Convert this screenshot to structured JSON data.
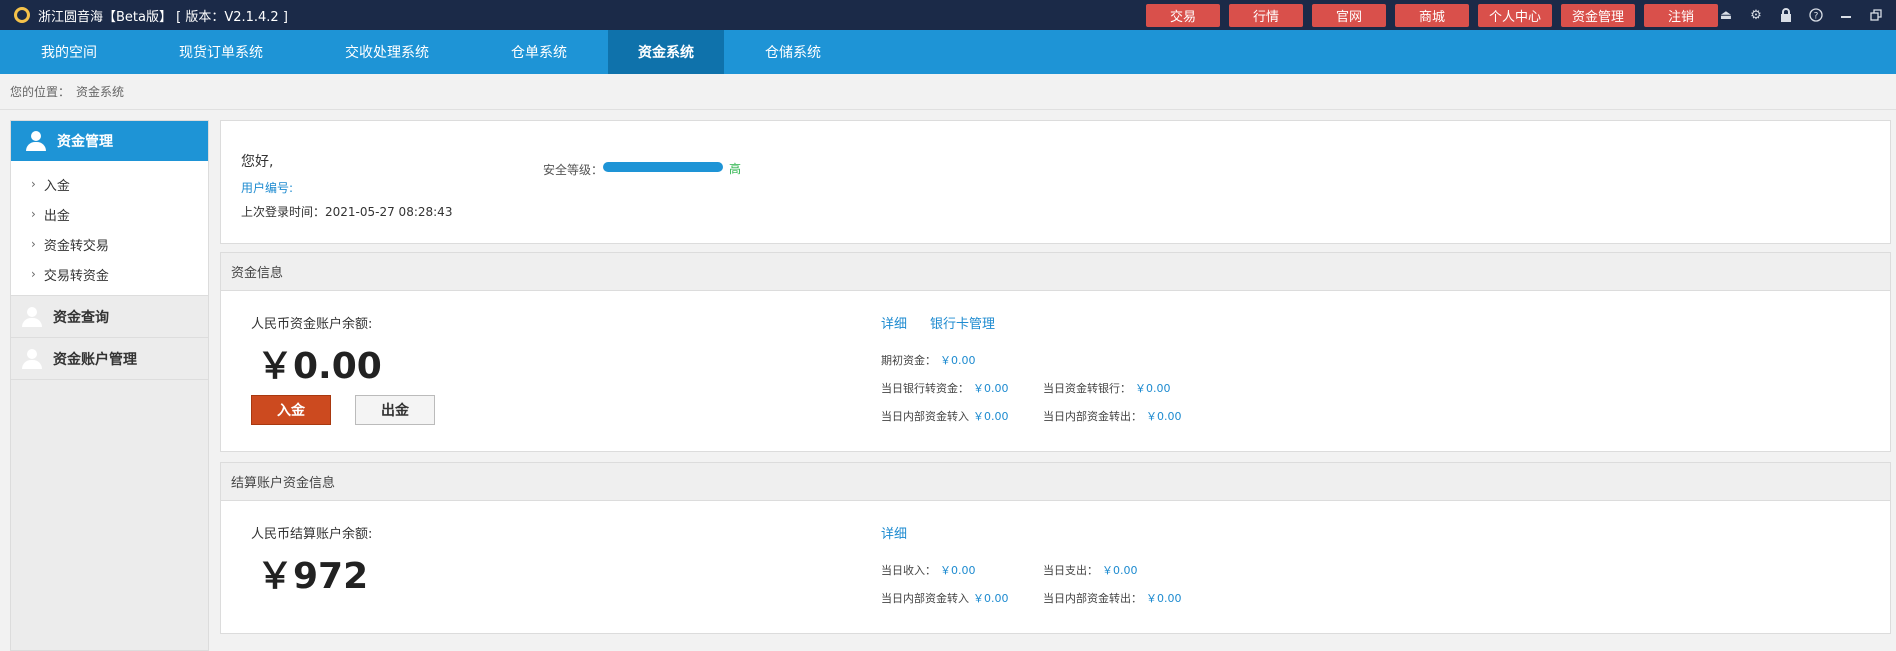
{
  "app": {
    "title": "浙江圆音海【Beta版】 [ 版本：V2.1.4.2 ]"
  },
  "top_buttons": [
    "交易",
    "行情",
    "官网",
    "商城",
    "个人中心",
    "资金管理",
    "注销"
  ],
  "window_icons": [
    "eject-icon",
    "gear-icon",
    "lock-icon",
    "help-icon",
    "minimize-icon",
    "restore-icon"
  ],
  "nav": {
    "items": [
      "我的空间",
      "现货订单系统",
      "交收处理系统",
      "仓单系统",
      "资金系统",
      "仓储系统"
    ],
    "active": "资金系统"
  },
  "breadcrumb": {
    "label": "您的位置：",
    "current": "资金系统"
  },
  "sidebar": {
    "head": "资金管理",
    "sub_items": [
      "入金",
      "出金",
      "资金转交易",
      "交易转资金"
    ],
    "groups": [
      "资金查询",
      "资金账户管理"
    ]
  },
  "welcome": {
    "greeting": "您好,",
    "user_no_label": "用户编号:",
    "last_login": "上次登录时间：2021-05-27 08:28:43",
    "security_label": "安全等级：",
    "security_level": "高",
    "security_fill": 1.0
  },
  "fund_info": {
    "title": "资金信息",
    "balance_label": "人民币资金账户余额:",
    "balance": "￥0.00",
    "deposit_button": "入金",
    "withdraw_button": "出金",
    "detail_link": "详细",
    "bank_card_link": "银行卡管理",
    "initial_label": "期初资金：",
    "initial_value": "￥0.00",
    "bank_to_fund_label": "当日银行转资金：",
    "bank_to_fund_value": "￥0.00",
    "fund_to_bank_label": "当日资金转银行：",
    "fund_to_bank_value": "￥0.00",
    "internal_in_label": "当日内部资金转入",
    "internal_in_value": "￥0.00",
    "internal_out_label": "当日内部资金转出：",
    "internal_out_value": "￥0.00"
  },
  "settle_info": {
    "title": "结算账户资金信息",
    "balance_label": "人民币结算账户余额:",
    "balance": "￥972",
    "detail_link": "详细",
    "income_label": "当日收入：",
    "income_value": "￥0.00",
    "expense_label": "当日支出：",
    "expense_value": "￥0.00",
    "internal_in_label": "当日内部资金转入",
    "internal_in_value": "￥0.00",
    "internal_out_label": "当日内部资金转出：",
    "internal_out_value": "￥0.00"
  },
  "colors": {
    "titlebar": "#1b2a48",
    "nav": "#1e94d6",
    "nav_active": "#0f72ab",
    "top_button": "#d9504b",
    "deposit": "#cc4a1f",
    "link": "#1e8bd0",
    "security_high": "#29b34a"
  }
}
